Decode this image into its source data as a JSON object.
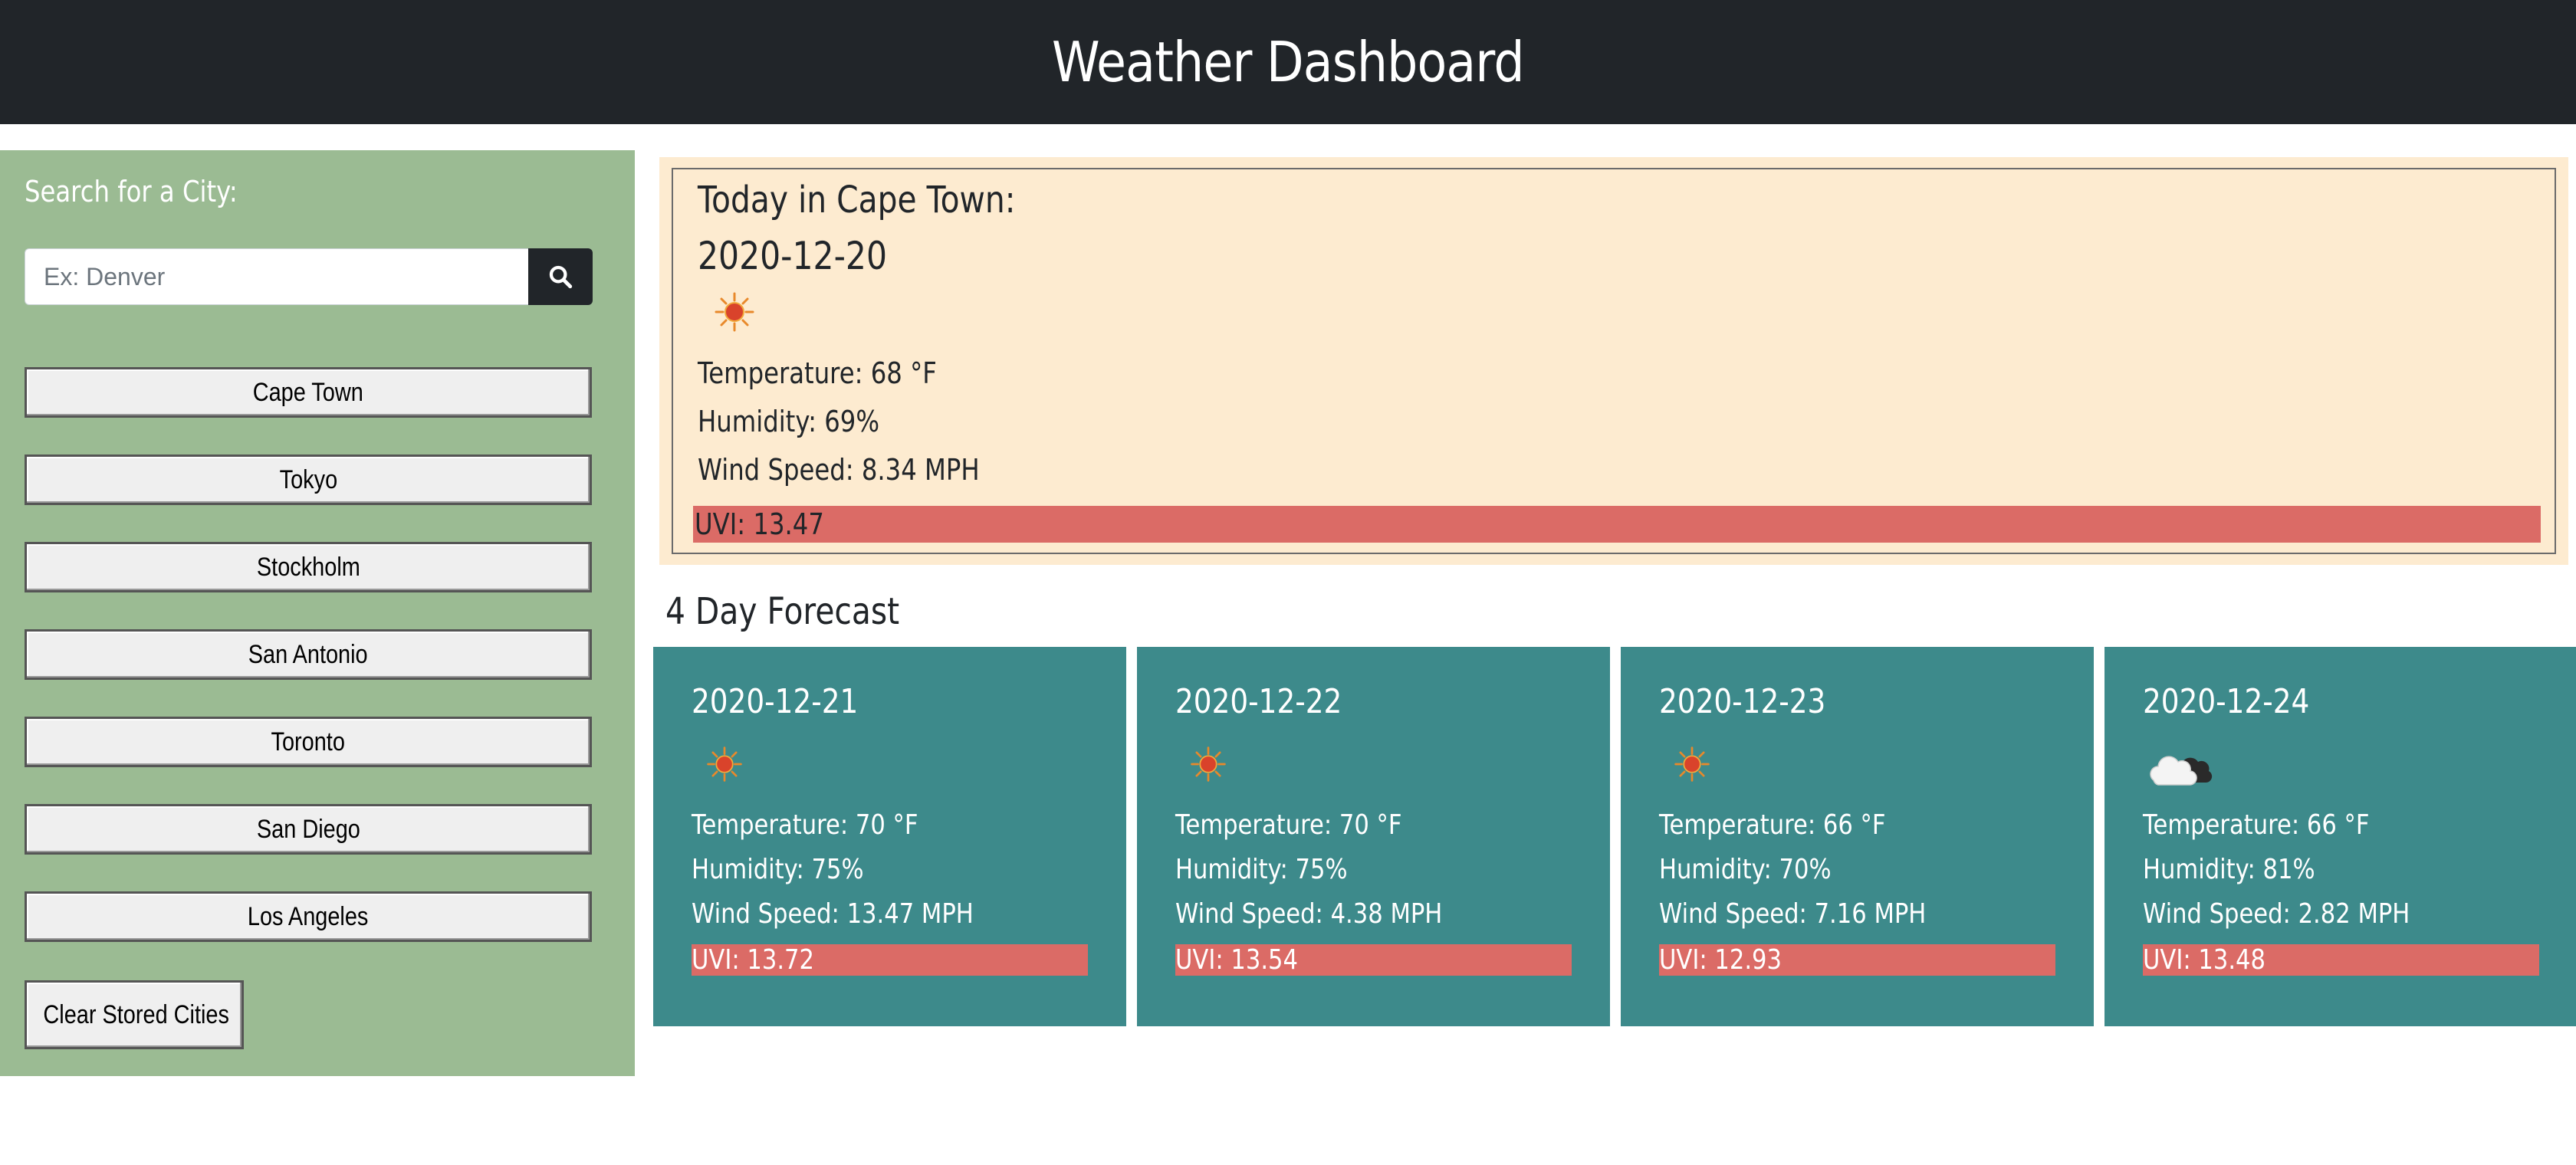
{
  "header": {
    "title": "Weather Dashboard"
  },
  "sidebar": {
    "search_label": "Search for a City:",
    "search_placeholder": "Ex: Denver",
    "search_value": "",
    "search_button_icon": "search-icon",
    "cities": [
      {
        "label": "Cape Town"
      },
      {
        "label": "Tokyo"
      },
      {
        "label": "Stockholm"
      },
      {
        "label": "San Antonio"
      },
      {
        "label": "Toronto"
      },
      {
        "label": "San Diego"
      },
      {
        "label": "Los Angeles"
      }
    ],
    "clear_label": "Clear Stored Cities"
  },
  "today": {
    "title": "Today in Cape Town:",
    "date": "2020-12-20",
    "icon": "sun-icon",
    "temperature": "Temperature: 68 °F",
    "humidity": "Humidity: 69%",
    "wind": "Wind Speed: 8.34 MPH",
    "uvi": "UVI: 13.47"
  },
  "forecast": {
    "heading": "4 Day Forecast",
    "days": [
      {
        "date": "2020-12-21",
        "icon": "sun-icon",
        "temperature": "Temperature: 70 °F",
        "humidity": "Humidity: 75%",
        "wind": "Wind Speed: 13.47 MPH",
        "uvi": "UVI: 13.72"
      },
      {
        "date": "2020-12-22",
        "icon": "sun-icon",
        "temperature": "Temperature: 70 °F",
        "humidity": "Humidity: 75%",
        "wind": "Wind Speed: 4.38 MPH",
        "uvi": "UVI: 13.54"
      },
      {
        "date": "2020-12-23",
        "icon": "sun-icon",
        "temperature": "Temperature: 66 °F",
        "humidity": "Humidity: 70%",
        "wind": "Wind Speed: 7.16 MPH",
        "uvi": "UVI: 12.93"
      },
      {
        "date": "2020-12-24",
        "icon": "cloudy-night-icon",
        "temperature": "Temperature: 66 °F",
        "humidity": "Humidity: 81%",
        "wind": "Wind Speed: 2.82 MPH",
        "uvi": "UVI: 13.48"
      }
    ]
  },
  "colors": {
    "header_bg": "#212529",
    "sidebar_bg": "#9bbb93",
    "today_bg": "#fdebd0",
    "forecast_bg": "#3d8a8b",
    "uvi_bg": "#db6b66"
  }
}
